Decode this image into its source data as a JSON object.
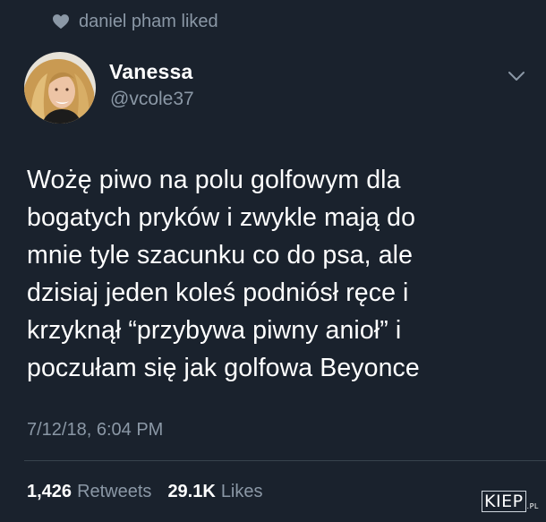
{
  "social_context": {
    "text": "daniel pham liked",
    "icon": "heart-icon"
  },
  "author": {
    "name": "Vanessa",
    "handle": "@vcole37"
  },
  "tweet": {
    "text": "Wożę piwo na polu golfowym dla\nbogatych pryków i zwykle mają do\nmnie tyle szacunku co do psa, ale\ndzisiaj jeden koleś podniósł ręce i\nkrzyknął “przybywa piwny anioł” i\npoczułam się jak golfowa Beyonce",
    "timestamp": "7/12/18, 6:04 PM"
  },
  "stats": {
    "retweets_count": "1,426",
    "retweets_label": "Retweets",
    "likes_count": "29.1K",
    "likes_label": "Likes"
  },
  "watermark": {
    "text": "KIEP",
    "suffix": ".PL"
  },
  "colors": {
    "background": "#1a222d",
    "secondary_text": "#8b98a6",
    "primary_text": "#ffffff"
  }
}
